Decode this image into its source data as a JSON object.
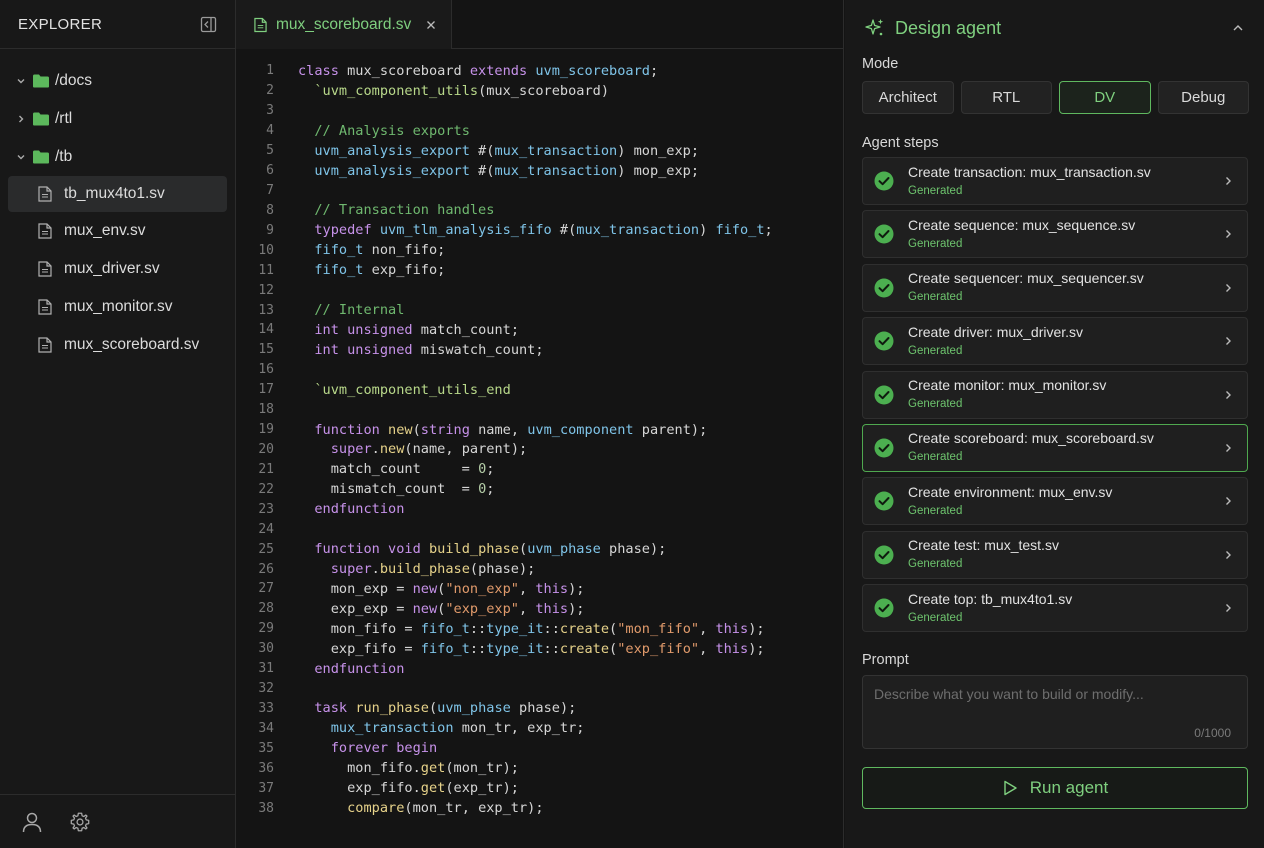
{
  "explorer": {
    "title": "EXPLORER",
    "folders": [
      {
        "label": "/docs",
        "expanded": false
      },
      {
        "label": "/rtl",
        "expanded": false
      },
      {
        "label": "/tb",
        "expanded": true
      }
    ],
    "files": [
      {
        "label": "tb_mux4to1.sv",
        "selected": true
      },
      {
        "label": "mux_env.sv",
        "selected": false
      },
      {
        "label": "mux_driver.sv",
        "selected": false
      },
      {
        "label": "mux_monitor.sv",
        "selected": false
      },
      {
        "label": "mux_scoreboard.sv",
        "selected": false
      }
    ]
  },
  "editor": {
    "tab_label": "mux_scoreboard.sv",
    "line_numbers": [
      "1",
      "2",
      "3",
      "4",
      "5",
      "6",
      "7",
      "8",
      "9",
      "10",
      "11",
      "12",
      "13",
      "14",
      "15",
      "16",
      "17",
      "18",
      "19",
      "20",
      "21",
      "22",
      "23",
      "24",
      "25",
      "26",
      "27",
      "28",
      "29",
      "30",
      "31",
      "32",
      "33",
      "34",
      "35",
      "36",
      "37",
      "38"
    ],
    "code_lines": [
      "class mux_scoreboard extends uvm_scoreboard;",
      "  `uvm_component_utils(mux_scoreboard)",
      "",
      "  // Analysis exports",
      "  uvm_analysis_export #(mux_transaction) mon_exp;",
      "  uvm_analysis_export #(mux_transaction) mop_exp;",
      "",
      "  // Transaction handles",
      "  typedef uvm_tlm_analysis_fifo #(mux_transaction) fifo_t;",
      "  fifo_t non_fifo;",
      "  fifo_t exp_fifo;",
      "",
      "  // Internal",
      "  int unsigned match_count;",
      "  int unsigned miswatch_count;",
      "",
      "  `uvm_component_utils_end",
      "",
      "  function new(string name, uvm_component parent);",
      "    super.new(name, parent);",
      "    match_count     = 0;",
      "    mismatch_count  = 0;",
      "  endfunction",
      "",
      "  function void build_phase(uvm_phase phase);",
      "    super.build_phase(phase);",
      "    mon_exp = new(\"non_exp\", this);",
      "    exp_exp = new(\"exp_exp\", this);",
      "    mon_fifo = fifo_t::type_it::create(\"mon_fifo\", this);",
      "    exp_fifo = fifo_t::type_it::create(\"exp_fifo\", this);",
      "  endfunction",
      "",
      "  task run_phase(uvm_phase phase);",
      "    mux_transaction mon_tr, exp_tr;",
      "    forever begin",
      "      mon_fifo.get(mon_tr);",
      "      exp_fifo.get(exp_tr);",
      "      compare(mon_tr, exp_tr);"
    ]
  },
  "agent": {
    "title": "Design agent",
    "mode_label": "Mode",
    "modes": [
      {
        "label": "Architect",
        "active": false
      },
      {
        "label": "RTL",
        "active": false
      },
      {
        "label": "DV",
        "active": true
      },
      {
        "label": "Debug",
        "active": false
      }
    ],
    "steps_label": "Agent steps",
    "steps": [
      {
        "name": "Create transaction: mux_transaction.sv",
        "status": "Generated",
        "active": false
      },
      {
        "name": "Create sequence: mux_sequence.sv",
        "status": "Generated",
        "active": false
      },
      {
        "name": "Create sequencer: mux_sequencer.sv",
        "status": "Generated",
        "active": false
      },
      {
        "name": "Create driver: mux_driver.sv",
        "status": "Generated",
        "active": false
      },
      {
        "name": "Create monitor: mux_monitor.sv",
        "status": "Generated",
        "active": false
      },
      {
        "name": "Create scoreboard: mux_scoreboard.sv",
        "status": "Generated",
        "active": true
      },
      {
        "name": "Create environment: mux_env.sv",
        "status": "Generated",
        "active": false
      },
      {
        "name": "Create test: mux_test.sv",
        "status": "Generated",
        "active": false
      },
      {
        "name": "Create top: tb_mux4to1.sv",
        "status": "Generated",
        "active": false
      }
    ],
    "prompt_label": "Prompt",
    "prompt_placeholder": "Describe what you want to build or modify...",
    "prompt_value": "",
    "prompt_counter": "0/1000",
    "run_label": "Run agent"
  },
  "colors": {
    "accent": "#7fd07f",
    "folder": "#5cb85c",
    "check": "#4caf50"
  },
  "icons": {
    "collapse_sidebar": "sidebar-collapse-icon",
    "folder": "folder-icon",
    "file": "file-icon",
    "user": "user-icon",
    "settings": "gear-icon",
    "spark": "sparkle-icon",
    "check": "check-circle-icon",
    "play": "play-icon"
  }
}
